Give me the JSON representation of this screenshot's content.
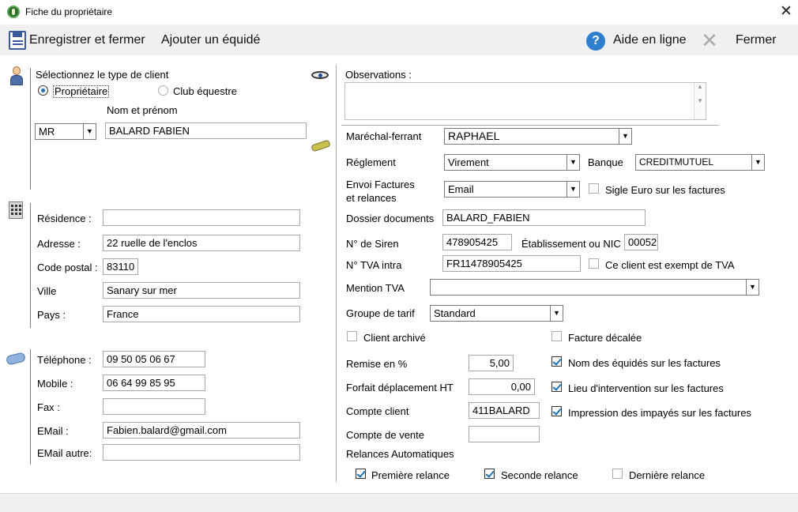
{
  "window": {
    "title": "Fiche du propriétaire",
    "close_glyph": "✕"
  },
  "toolbar": {
    "save_close": "Enregistrer et fermer",
    "add_horse": "Ajouter un équidé",
    "help": "Aide en ligne",
    "help_glyph": "?",
    "close": "Fermer",
    "close_glyph": "✕"
  },
  "client": {
    "type_label": "Sélectionnez le type de client",
    "option_owner": "Propriétaire",
    "option_club": "Club équestre",
    "selected_type": "Propriétaire",
    "name_label": "Nom et prénom",
    "civility": "MR",
    "name": "BALARD FABIEN"
  },
  "address": {
    "residence_label": "Résidence :",
    "residence": "",
    "street_label": "Adresse :",
    "street": "22 ruelle de l'enclos",
    "postal_label": "Code postal :",
    "postal": "83110",
    "city_label": "Ville",
    "city": "Sanary sur mer",
    "country_label": "Pays :",
    "country": "France"
  },
  "contact": {
    "phone_label": "Téléphone :",
    "phone": "09 50 05 06 67",
    "mobile_label": "Mobile :",
    "mobile": "06 64 99 85 95",
    "fax_label": "Fax :",
    "fax": "",
    "email_label": "EMail :",
    "email": "Fabien.balard@gmail.com",
    "email2_label": "EMail autre:",
    "email2": ""
  },
  "details": {
    "observations_label": "Observations :",
    "observations": "",
    "farrier_label": "Maréchal-ferrant",
    "farrier": "RAPHAEL",
    "payment_label": "Réglement",
    "payment": "Virement",
    "bank_label": "Banque",
    "bank": "CREDITMUTUEL",
    "invoice_send_label_1": "Envoi Factures",
    "invoice_send_label_2": "et relances",
    "invoice_send": "Email",
    "euro_sign_label": "Sigle Euro sur les factures",
    "euro_sign": false,
    "docs_label": "Dossier documents",
    "docs": "BALARD_FABIEN",
    "siren_label": "N° de Siren",
    "siren": "478905425",
    "nic_label": "Établissement ou NIC",
    "nic": "00052",
    "vat_label": "N° TVA intra",
    "vat": "FR11478905425",
    "vat_exempt_label": "Ce client est exempt de TVA",
    "vat_exempt": false,
    "vat_mention_label": "Mention TVA",
    "vat_mention": "",
    "tariff_label": "Groupe de tarif",
    "tariff": "Standard",
    "archived_label": "Client archivé",
    "archived": false,
    "deferred_label": "Facture décalée",
    "deferred": false,
    "discount_label": "Remise en %",
    "discount": "5,00",
    "horse_names_label": "Nom des équidés sur les factures",
    "horse_names": true,
    "travel_label": "Forfait déplacement HT",
    "travel": "0,00",
    "location_label": "Lieu d'intervention sur les factures",
    "location": true,
    "account_label": "Compte client",
    "account": "411BALARD",
    "unpaid_label": "Impression des impayés sur les factures",
    "unpaid": true,
    "sales_account_label": "Compte de vente",
    "sales_account": "",
    "reminders_label": "Relances Automatiques",
    "first_reminder_label": "Première relance",
    "first_reminder": true,
    "second_reminder_label": "Seconde relance",
    "second_reminder": true,
    "last_reminder_label": "Dernière relance",
    "last_reminder": false
  },
  "icons": {
    "app": "app-logo-icon",
    "save": "save-icon",
    "help": "help-icon",
    "close": "close-icon",
    "person": "person-icon",
    "eye": "eye-icon",
    "pen": "signature-pen-icon",
    "building": "building-icon",
    "phone": "phone-icon"
  },
  "colors": {
    "accent": "#1a73b8",
    "toolbar_bg": "#f0f0f0"
  }
}
